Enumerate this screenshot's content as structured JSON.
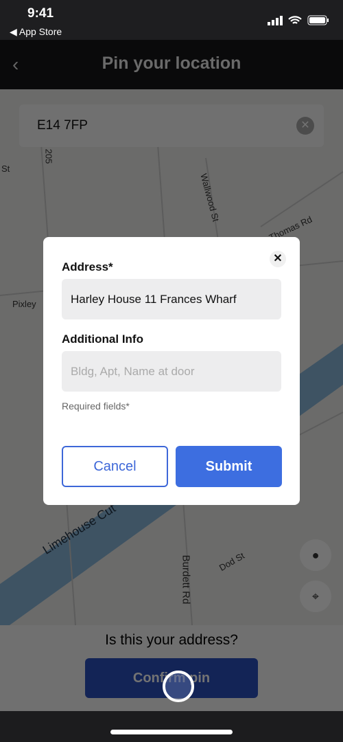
{
  "status_bar": {
    "time": "9:41",
    "back_app": "◀ App Store"
  },
  "nav": {
    "title": "Pin your location",
    "back_icon": "chevron-left-icon"
  },
  "search": {
    "value": "E14 7FP"
  },
  "map": {
    "labels": [
      "St",
      "205",
      "Wallwood St",
      "Thomas Rd",
      "Pixley",
      "Limehouse Cut",
      "Burdett Rd",
      "Dod St"
    ]
  },
  "bottom": {
    "question": "Is this your address?",
    "confirm_label": "Confirm pin"
  },
  "modal": {
    "address_label": "Address*",
    "address_value": "Harley House 11 Frances Wharf",
    "additional_label": "Additional Info",
    "additional_placeholder": "Bldg, Apt, Name at door",
    "required_note": "Required fields*",
    "cancel_label": "Cancel",
    "submit_label": "Submit"
  },
  "colors": {
    "primary": "#3d6ee0",
    "canal": "#8ab8dc"
  }
}
